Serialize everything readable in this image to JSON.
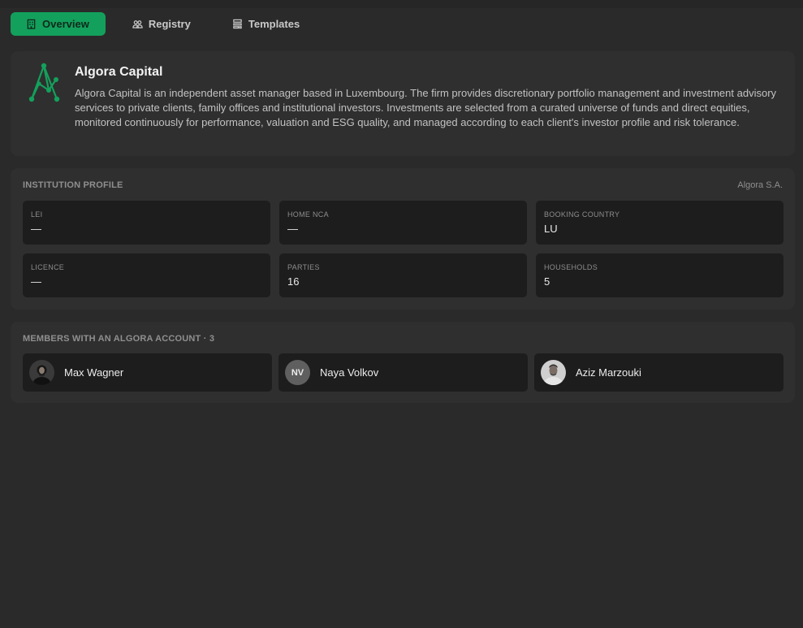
{
  "tabs": [
    {
      "label": "Overview",
      "icon": "building-icon",
      "active": true
    },
    {
      "label": "Registry",
      "icon": "users-icon",
      "active": false
    },
    {
      "label": "Templates",
      "icon": "template-icon",
      "active": false
    }
  ],
  "about": {
    "title": "Algora Capital",
    "description": "Algora Capital is an independent asset manager based in Luxembourg. The firm provides discretionary portfolio management and investment advisory services to private clients, family offices and institutional investors. Investments are selected from a curated universe of funds and direct equities, monitored continuously for performance, valuation and ESG quality, and managed according to each client's investor profile and risk tolerance."
  },
  "profile": {
    "label": "INSTITUTION PROFILE",
    "entity": "Algora S.A.",
    "fields": [
      {
        "label": "LEI",
        "value": "—"
      },
      {
        "label": "HOME NCA",
        "value": "—"
      },
      {
        "label": "BOOKING COUNTRY",
        "value": "LU"
      },
      {
        "label": "LICENCE",
        "value": "—"
      },
      {
        "label": "PARTIES",
        "value": "16"
      },
      {
        "label": "HOUSEHOLDS",
        "value": "5"
      }
    ]
  },
  "members": {
    "label": "MEMBERS WITH AN ALGORA ACCOUNT · 3",
    "items": [
      {
        "name": "Max Wagner",
        "avatar": "photo"
      },
      {
        "name": "Naya Volkov",
        "avatar": "initials",
        "initials": "NV"
      },
      {
        "name": "Aziz Marzouki",
        "avatar": "photo"
      }
    ]
  },
  "colors": {
    "accent": "#13a05c",
    "background": "#2a2a2a",
    "card": "#2f2f2f",
    "field": "#1d1d1d"
  }
}
